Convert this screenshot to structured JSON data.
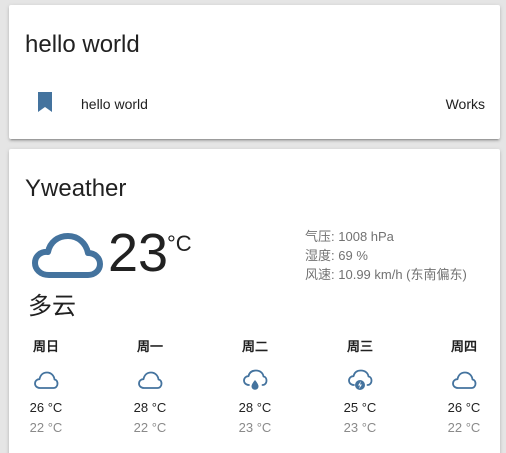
{
  "entities_card": {
    "title": "hello world",
    "row": {
      "icon": "bookmark-icon",
      "name": "hello world",
      "state": "Works"
    }
  },
  "weather_card": {
    "title": "Yweather",
    "current": {
      "icon": "cloud-icon",
      "temperature": "23",
      "unit": "°C",
      "condition": "多云"
    },
    "attributes": [
      {
        "label": "气压",
        "value": "1008 hPa"
      },
      {
        "label": "湿度",
        "value": "69 %"
      },
      {
        "label": "风速",
        "value": "10.99 km/h (东南偏东)"
      }
    ],
    "forecast": [
      {
        "day": "周日",
        "icon": "cloud-icon",
        "high": "26 °C",
        "low": "22 °C"
      },
      {
        "day": "周一",
        "icon": "cloud-icon",
        "high": "28 °C",
        "low": "22 °C"
      },
      {
        "day": "周二",
        "icon": "rain-cloud-icon",
        "high": "28 °C",
        "low": "23 °C"
      },
      {
        "day": "周三",
        "icon": "thunderstorm-cloud-icon",
        "high": "25 °C",
        "low": "23 °C"
      },
      {
        "day": "周四",
        "icon": "cloud-icon",
        "high": "26 °C",
        "low": "22 °C"
      }
    ]
  },
  "colors": {
    "icon_blue": "#44739e",
    "background": "#e5e5e5",
    "card": "#ffffff",
    "secondary_text": "#727272"
  }
}
